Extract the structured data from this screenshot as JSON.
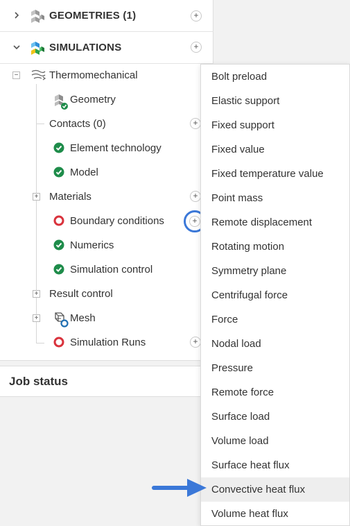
{
  "tree": {
    "geometries": {
      "label": "GEOMETRIES (1)",
      "expanded": false
    },
    "simulations": {
      "label": "SIMULATIONS",
      "expanded": true
    },
    "simulation": {
      "name": "Thermomechanical",
      "items": {
        "geometry": {
          "label": "Geometry",
          "status": "valid"
        },
        "contacts": {
          "label": "Contacts (0)"
        },
        "element_technology": {
          "label": "Element technology",
          "status": "valid"
        },
        "model": {
          "label": "Model",
          "status": "valid"
        },
        "materials": {
          "label": "Materials"
        },
        "boundary_conditions": {
          "label": "Boundary conditions",
          "status": "invalid"
        },
        "numerics": {
          "label": "Numerics",
          "status": "valid"
        },
        "simulation_control": {
          "label": "Simulation control",
          "status": "valid"
        },
        "result_control": {
          "label": "Result control"
        },
        "mesh": {
          "label": "Mesh",
          "status": "pending"
        },
        "simulation_runs": {
          "label": "Simulation Runs",
          "status": "invalid"
        }
      }
    },
    "plus_symbol": "+",
    "expand_symbol": "+",
    "collapse_symbol": "−"
  },
  "job_status": {
    "label": "Job status"
  },
  "dropdown": {
    "items": [
      "Bolt preload",
      "Elastic support",
      "Fixed support",
      "Fixed value",
      "Fixed temperature value",
      "Point mass",
      "Remote displacement",
      "Rotating motion",
      "Symmetry plane",
      "Centrifugal force",
      "Force",
      "Nodal load",
      "Pressure",
      "Remote force",
      "Surface load",
      "Volume load",
      "Surface heat flux",
      "Convective heat flux",
      "Volume heat flux"
    ],
    "highlighted_item": "Convective heat flux"
  },
  "colors": {
    "valid_green": "#1e8c4a",
    "invalid_red": "#d9323c",
    "pending_blue": "#1f6fb2",
    "focus_blue": "#3b78d8",
    "highlight_bg": "#eeeeee"
  },
  "icons": {
    "geometries": "cube-stack-icon",
    "simulations": "colored-cube-stack-icon",
    "thermomechanical": "heat-flow-icon",
    "geometry": "cube-check-icon",
    "mesh": "mesh-icon",
    "chevron_collapsed": "chevron-right-icon",
    "chevron_expanded": "chevron-down-icon",
    "annotation": "arrow-right-icon"
  }
}
